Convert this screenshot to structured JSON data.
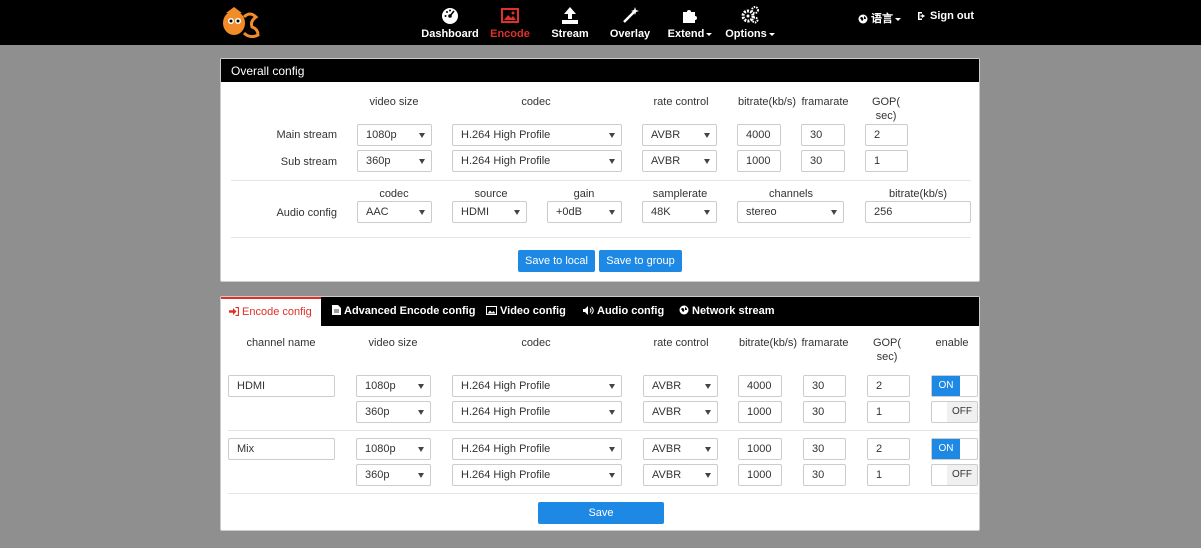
{
  "nav": {
    "items": [
      {
        "label": "Dashboard",
        "icon": "dashboard-icon"
      },
      {
        "label": "Encode",
        "icon": "image-icon",
        "active": true
      },
      {
        "label": "Stream",
        "icon": "upload-icon"
      },
      {
        "label": "Overlay",
        "icon": "magic-wand-icon"
      },
      {
        "label": "Extend",
        "icon": "puzzle-icon"
      },
      {
        "label": "Options",
        "icon": "gears-icon"
      }
    ],
    "language": "语言",
    "signout": "Sign out",
    "accent": "#e0302a"
  },
  "overall": {
    "title": "Overall config",
    "headers": {
      "video_size": "video size",
      "codec": "codec",
      "rate_control": "rate control",
      "bitrate": "bitrate(kb/s)",
      "framerate": "framarate",
      "gop": "GOP(\nsec)"
    },
    "main": {
      "label": "Main stream",
      "size": "1080p",
      "codec": "H.264 High Profile",
      "rc": "AVBR",
      "bitrate": "4000",
      "fps": "30",
      "gop": "2"
    },
    "sub": {
      "label": "Sub stream",
      "size": "360p",
      "codec": "H.264 High Profile",
      "rc": "AVBR",
      "bitrate": "1000",
      "fps": "30",
      "gop": "1"
    },
    "audio_headers": {
      "codec": "codec",
      "source": "source",
      "gain": "gain",
      "samplerate": "samplerate",
      "channels": "channels",
      "bitrate": "bitrate(kb/s)"
    },
    "audio": {
      "label": "Audio config",
      "codec": "AAC",
      "source": "HDMI",
      "gain": "+0dB",
      "samplerate": "48K",
      "channels": "stereo",
      "bitrate": "256"
    },
    "save_local": "Save to local",
    "save_group": "Save to group"
  },
  "tabs": [
    {
      "label": "Encode config",
      "active": true
    },
    {
      "label": "Advanced Encode config"
    },
    {
      "label": "Video config"
    },
    {
      "label": "Audio config"
    },
    {
      "label": "Network stream"
    }
  ],
  "encode": {
    "headers": {
      "channel": "channel name",
      "video_size": "video size",
      "codec": "codec",
      "rate_control": "rate control",
      "bitrate": "bitrate(kb/s)",
      "framerate": "framarate",
      "gop": "GOP(\nsec)",
      "enable": "enable"
    },
    "channels": [
      {
        "name": "HDMI",
        "rows": [
          {
            "size": "1080p",
            "codec": "H.264 High Profile",
            "rc": "AVBR",
            "bitrate": "4000",
            "fps": "30",
            "gop": "2",
            "enable": "ON"
          },
          {
            "size": "360p",
            "codec": "H.264 High Profile",
            "rc": "AVBR",
            "bitrate": "1000",
            "fps": "30",
            "gop": "1",
            "enable": "OFF"
          }
        ]
      },
      {
        "name": "Mix",
        "rows": [
          {
            "size": "1080p",
            "codec": "H.264 High Profile",
            "rc": "AVBR",
            "bitrate": "1000",
            "fps": "30",
            "gop": "2",
            "enable": "ON"
          },
          {
            "size": "360p",
            "codec": "H.264 High Profile",
            "rc": "AVBR",
            "bitrate": "1000",
            "fps": "30",
            "gop": "1",
            "enable": "OFF"
          }
        ]
      }
    ],
    "save": "Save"
  }
}
